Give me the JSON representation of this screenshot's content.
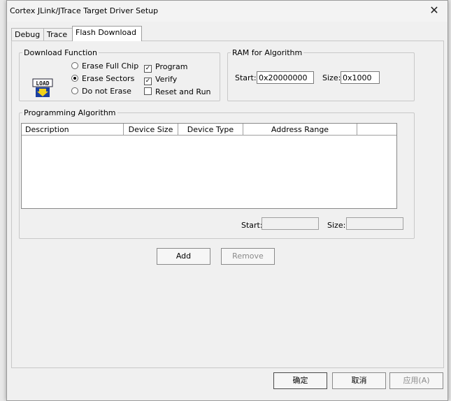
{
  "window": {
    "title": "Cortex JLink/JTrace Target Driver Setup",
    "close_glyph": "✕"
  },
  "tabs": [
    {
      "label": "Debug"
    },
    {
      "label": "Trace"
    },
    {
      "label": "Flash Download",
      "active": true
    }
  ],
  "download_function": {
    "legend": "Download Function",
    "icon_text": "LOAD",
    "erase_options": [
      {
        "label": "Erase Full Chip",
        "selected": false
      },
      {
        "label": "Erase Sectors",
        "selected": true
      },
      {
        "label": "Do not Erase",
        "selected": false
      }
    ],
    "checks": [
      {
        "label": "Program",
        "checked": true
      },
      {
        "label": "Verify",
        "checked": true
      },
      {
        "label": "Reset and Run",
        "checked": false
      }
    ]
  },
  "ram": {
    "legend": "RAM for Algorithm",
    "start_label": "Start:",
    "start_value": "0x20000000",
    "size_label": "Size:",
    "size_value": "0x1000"
  },
  "programming": {
    "legend": "Programming Algorithm",
    "columns": [
      "Description",
      "Device Size",
      "Device Type",
      "Address Range"
    ],
    "start_label": "Start:",
    "start_value": "",
    "size_label": "Size:",
    "size_value": ""
  },
  "actions": {
    "add": "Add",
    "remove": "Remove"
  },
  "footer": {
    "ok": "确定",
    "cancel": "取消",
    "apply": "应用(A)"
  }
}
